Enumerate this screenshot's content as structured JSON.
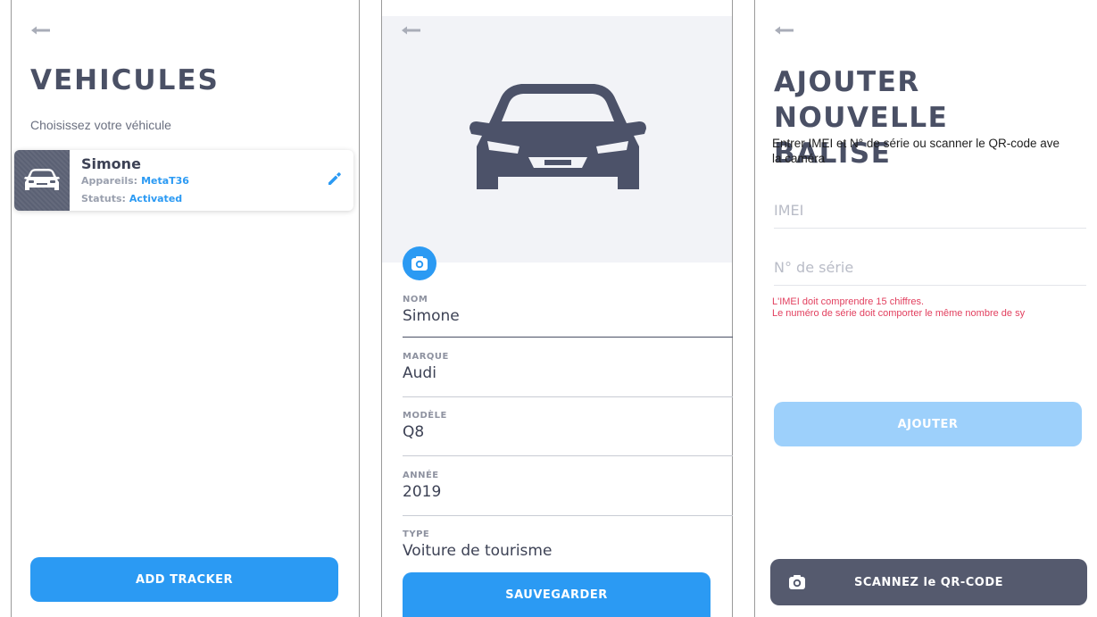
{
  "vehicles_screen": {
    "title": "VEHICULES",
    "subtitle": "Choisissez votre véhicule",
    "vehicle": {
      "name": "Simone",
      "devices_label": "Appareils:",
      "devices_value": "MetaT36",
      "status_label": "Statuts:",
      "status_value": "Activated"
    },
    "add_button": "ADD TRACKER"
  },
  "vehicle_detail_screen": {
    "fields": {
      "nom": {
        "label": "NOM",
        "value": "Simone"
      },
      "marque": {
        "label": "MARQUE",
        "value": "Audi"
      },
      "modele": {
        "label": "MODÈLE",
        "value": "Q8"
      },
      "annee": {
        "label": "ANNÉE",
        "value": "2019"
      },
      "type": {
        "label": "TYPE",
        "value": "Voiture de tourisme"
      }
    },
    "save_button": "SAUVEGARDER"
  },
  "add_beacon_screen": {
    "title_line1": "AJOUTER NOUVELLE",
    "title_line2": "BALISE",
    "instructions_line1": "Entrer IMEI et N° de série ou scanner le QR-code ave",
    "instructions_line2": "la caméra",
    "imei_placeholder": "IMEI",
    "serial_placeholder": "N° de série",
    "error_imei": "L'IMEI doit comprendre 15 chiffres.",
    "error_serial": "Le numéro de série doit comporter le même nombre de sy",
    "add_button": "AJOUTER",
    "scan_button": "SCANNEZ le QR-CODE"
  },
  "colors": {
    "accent": "#2b9af3",
    "accent_disabled": "#9dd0fb",
    "dark": "#4a5065",
    "error": "#e2405f"
  },
  "icons": [
    "back-arrow-icon",
    "car-icon",
    "pencil-icon",
    "camera-icon"
  ]
}
